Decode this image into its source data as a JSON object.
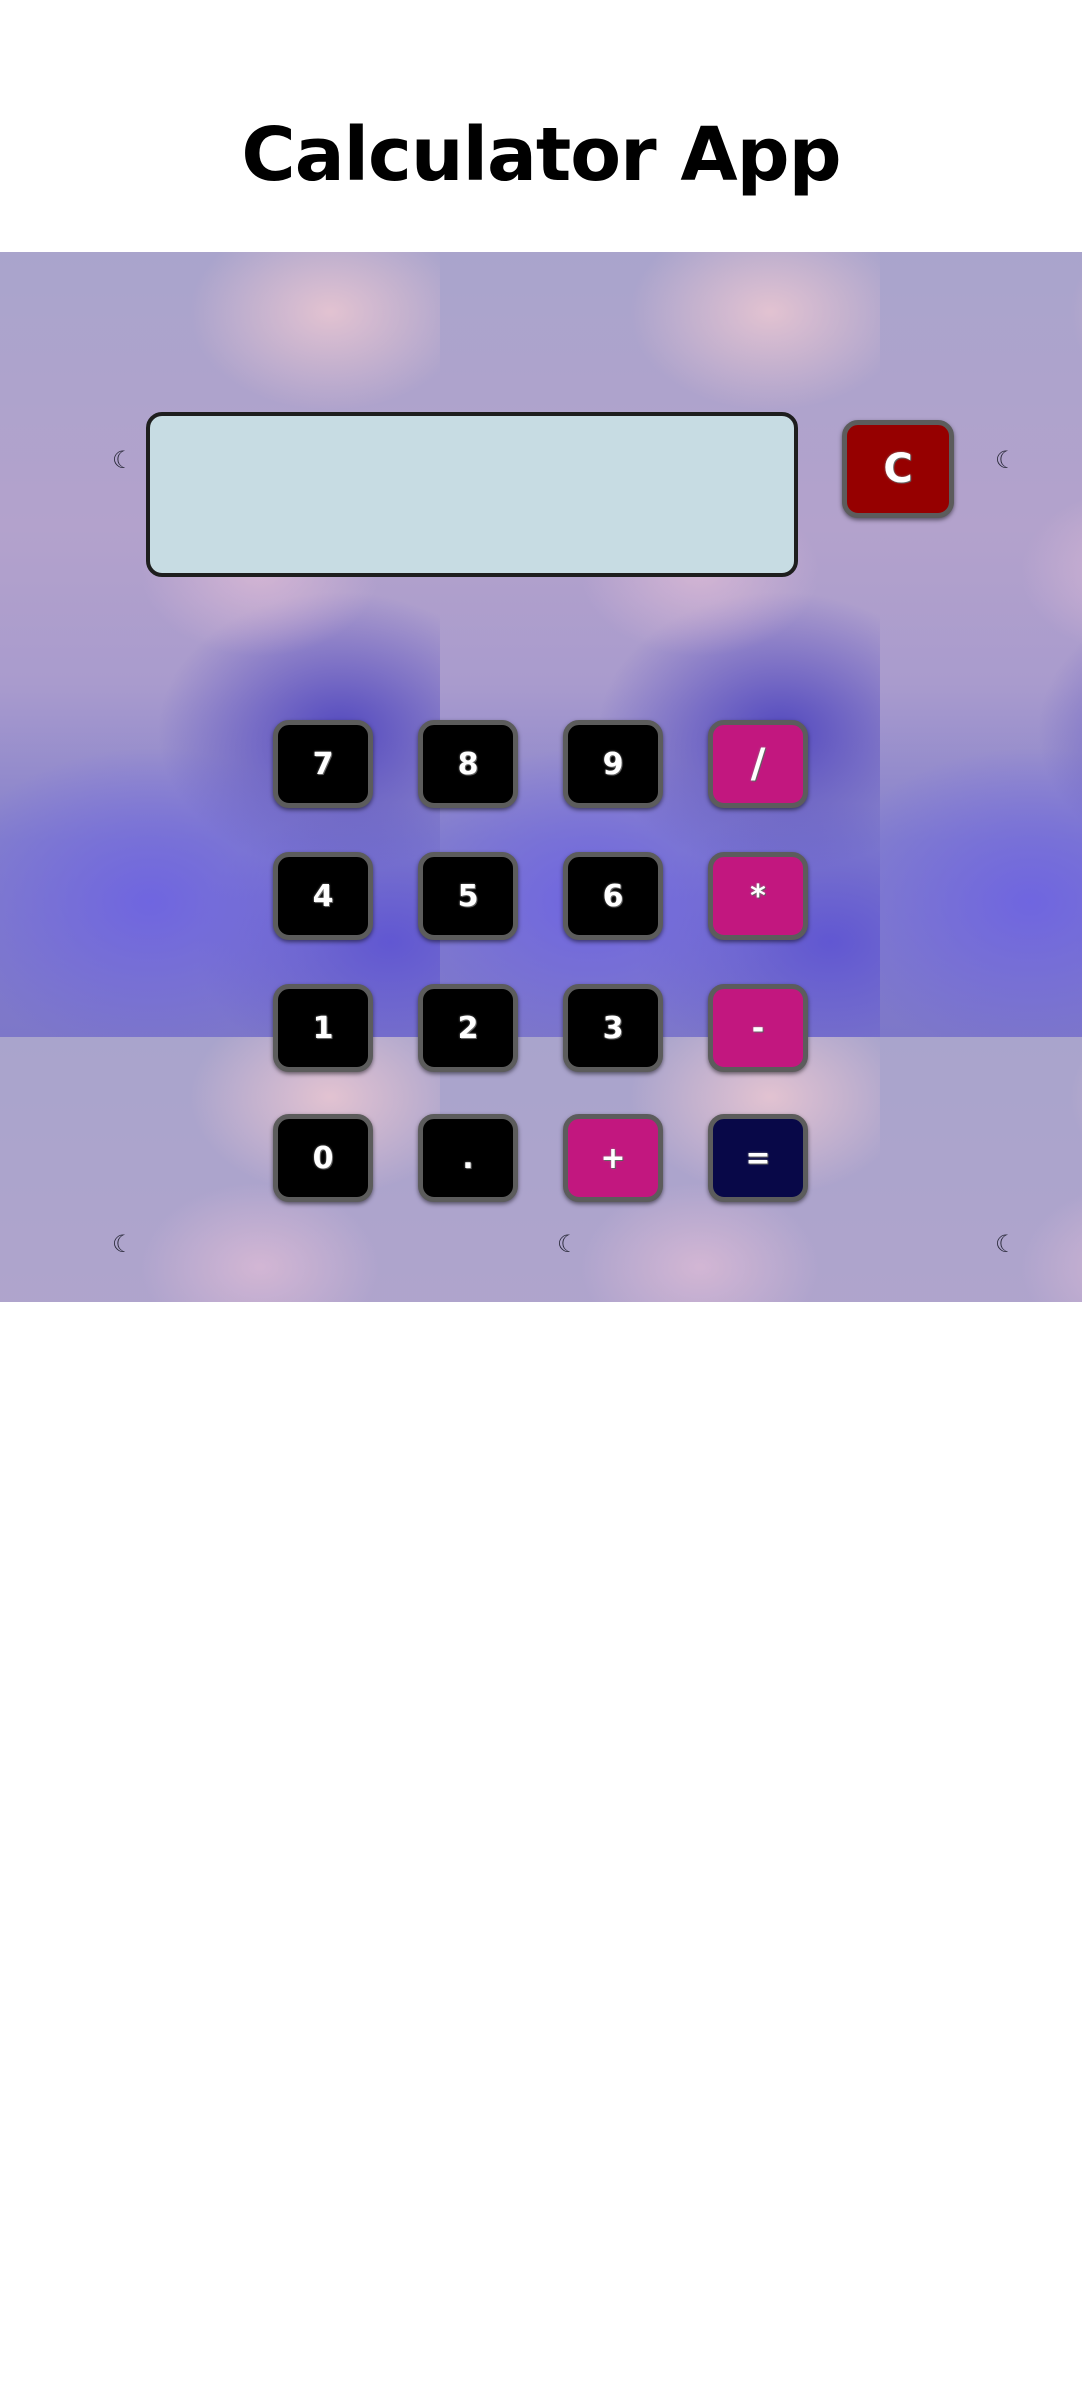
{
  "app": {
    "title": "Calculator App"
  },
  "display": {
    "value": ""
  },
  "buttons": {
    "clear": "C",
    "seven": "7",
    "eight": "8",
    "nine": "9",
    "divide": "/",
    "four": "4",
    "five": "5",
    "six": "6",
    "multiply": "*",
    "one": "1",
    "two": "2",
    "three": "3",
    "subtract": "-",
    "zero": "0",
    "decimal": ".",
    "add": "+",
    "equals": "="
  },
  "colors": {
    "digit_button": "#000000",
    "operator_button": "#c2177f",
    "equals_button": "#080848",
    "clear_button": "#960000",
    "display_background": "#c7dce3"
  },
  "icons": {
    "background_decoration": "crescent-moon-icon"
  }
}
